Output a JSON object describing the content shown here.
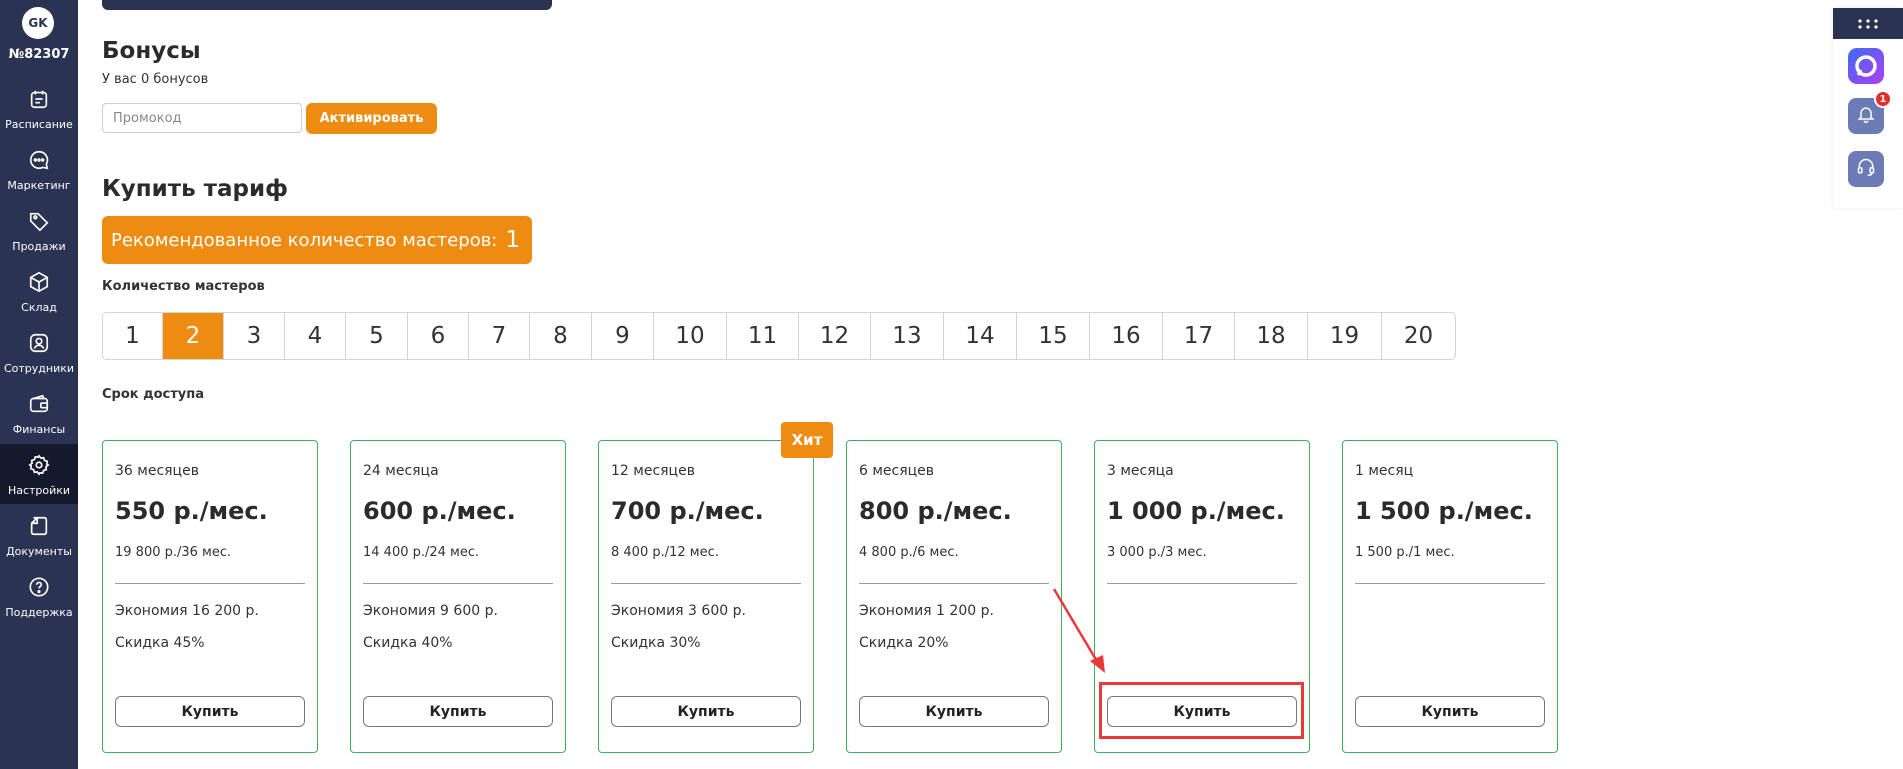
{
  "sidebar": {
    "avatar_initials": "GK",
    "account_number": "№82307",
    "items": [
      {
        "label": "Расписание",
        "icon": "calendar-icon"
      },
      {
        "label": "Маркетинг",
        "icon": "chat-icon"
      },
      {
        "label": "Продажи",
        "icon": "tag-icon"
      },
      {
        "label": "Склад",
        "icon": "box-icon"
      },
      {
        "label": "Сотрудники",
        "icon": "user-icon"
      },
      {
        "label": "Финансы",
        "icon": "wallet-icon"
      },
      {
        "label": "Настройки",
        "icon": "gear-icon",
        "active": true
      },
      {
        "label": "Документы",
        "icon": "document-icon"
      },
      {
        "label": "Поддержка",
        "icon": "help-icon"
      }
    ]
  },
  "bonuses": {
    "title": "Бонусы",
    "balance_text": "У вас 0 бонусов",
    "promo_placeholder": "Промокод",
    "activate_label": "Активировать"
  },
  "tariff": {
    "title": "Купить тариф",
    "recommended_label": "Рекомендованное количество мастеров:",
    "recommended_value": "1",
    "masters_label": "Количество мастеров",
    "masters_options": [
      "1",
      "2",
      "3",
      "4",
      "5",
      "6",
      "7",
      "8",
      "9",
      "10",
      "11",
      "12",
      "13",
      "14",
      "15",
      "16",
      "17",
      "18",
      "19",
      "20"
    ],
    "masters_selected": "2",
    "access_label": "Срок доступа",
    "hit_label": "Хит",
    "plans": [
      {
        "period": "36 месяцев",
        "price": "550 р./мес.",
        "total": "19 800 р./36 мес.",
        "economy": "Экономия 16 200 р.",
        "discount": "Скидка 45%",
        "buy_label": "Купить"
      },
      {
        "period": "24 месяца",
        "price": "600 р./мес.",
        "total": "14 400 р./24 мес.",
        "economy": "Экономия 9 600 р.",
        "discount": "Скидка 40%",
        "buy_label": "Купить"
      },
      {
        "period": "12 месяцев",
        "price": "700 р./мес.",
        "total": "8 400 р./12 мес.",
        "economy": "Экономия 3 600 р.",
        "discount": "Скидка 30%",
        "buy_label": "Купить"
      },
      {
        "period": "6 месяцев",
        "price": "800 р./мес.",
        "total": "4 800 р./6 мес.",
        "economy": "Экономия 1 200 р.",
        "discount": "Скидка 20%",
        "buy_label": "Купить"
      },
      {
        "period": "3 месяца",
        "price": "1 000 р./мес.",
        "total": "3 000 р./3 мес.",
        "economy": "",
        "discount": "",
        "buy_label": "Купить"
      },
      {
        "period": "1 месяц",
        "price": "1 500 р./мес.",
        "total": "1 500 р./1 мес.",
        "economy": "",
        "discount": "",
        "buy_label": "Купить"
      }
    ]
  },
  "right_widgets": {
    "notification_count": "1"
  },
  "colors": {
    "sidebar_bg": "#2a3452",
    "accent_orange": "#ee8c12",
    "card_border_green": "#3cb35a",
    "annotation_red": "#e83a3a"
  }
}
